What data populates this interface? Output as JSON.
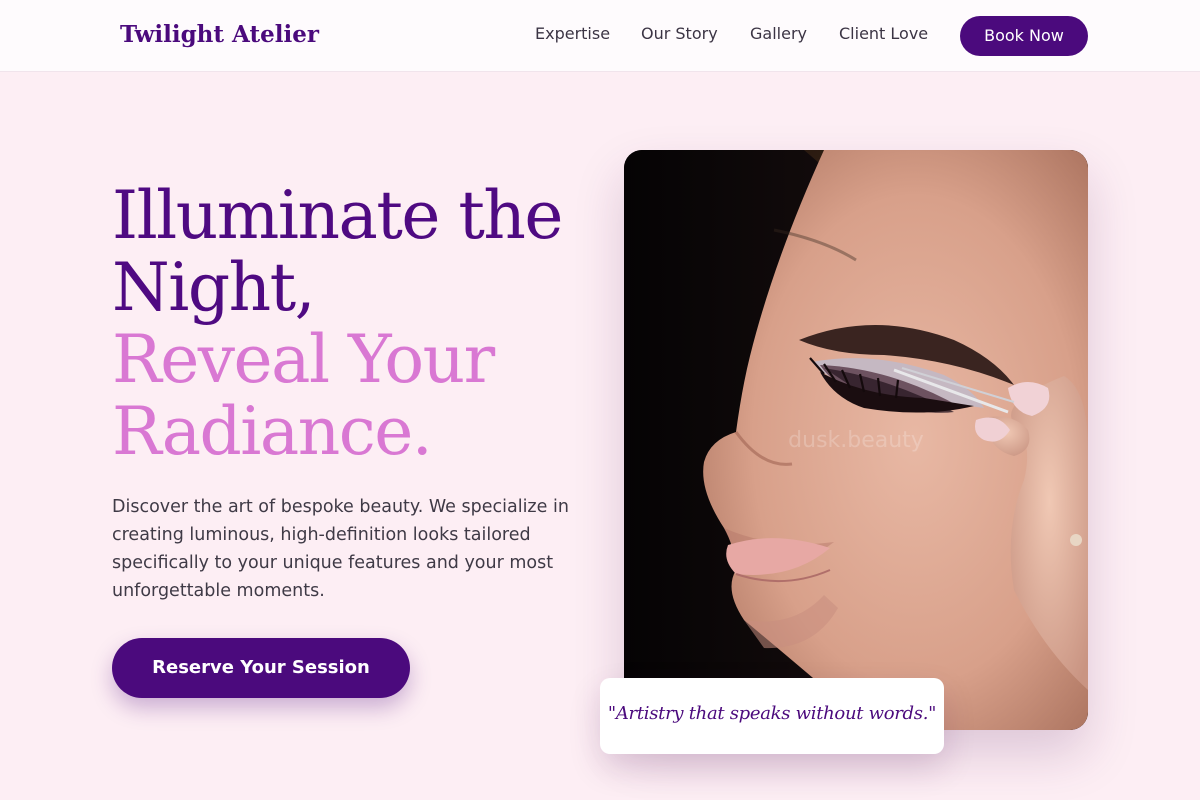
{
  "nav": {
    "brand": "Twilight Atelier",
    "links": [
      "Expertise",
      "Our Story",
      "Gallery",
      "Client Love"
    ],
    "cta_label": "Book Now"
  },
  "hero": {
    "headline_line1": "Illuminate the",
    "headline_line2": "Night,",
    "headline_line3": "Reveal Your",
    "headline_line4": "Radiance.",
    "intro": "Discover the art of bespoke beauty. We specialize in creating luminous, high-definition looks tailored specifically to your unique features and your most unforgettable moments.",
    "cta_label": "Reserve Your Session",
    "image_watermark": "dusk.beauty",
    "quote": "\"Artistry that speaks without words.\""
  },
  "colors": {
    "brand_purple": "#4b0a7d",
    "accent_pink": "#d978d3",
    "page_background": "#fdeef4"
  }
}
